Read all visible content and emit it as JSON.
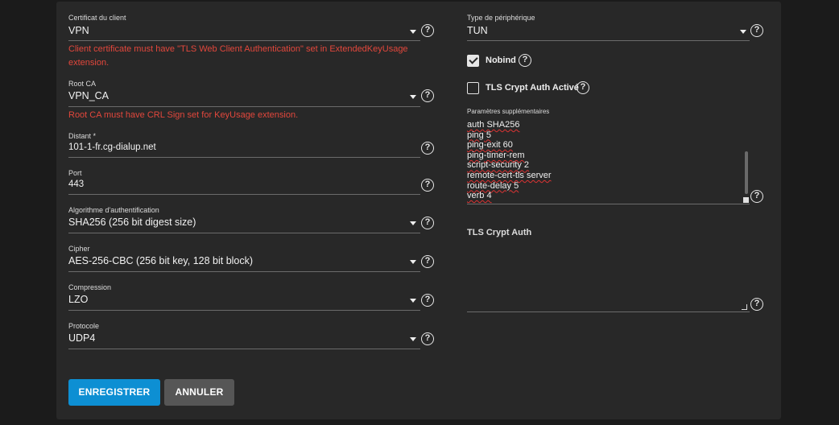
{
  "left": {
    "client_cert": {
      "label": "Certificat du client",
      "value": "VPN",
      "error": "Client certificate must have \"TLS Web Client Authentication\" set in ExtendedKeyUsage extension."
    },
    "root_ca": {
      "label": "Root CA",
      "value": "VPN_CA",
      "error": "Root CA must have CRL Sign set for KeyUsage extension."
    },
    "remote": {
      "label": "Distant *",
      "value": "101-1-fr.cg-dialup.net"
    },
    "port": {
      "label": "Port",
      "value": "443"
    },
    "auth_algo": {
      "label": "Algorithme d'authentification",
      "value": "SHA256 (256 bit digest size)"
    },
    "cipher": {
      "label": "Cipher",
      "value": "AES-256-CBC (256 bit key, 128 bit block)"
    },
    "compression": {
      "label": "Compression",
      "value": "LZO"
    },
    "protocol": {
      "label": "Protocole",
      "value": "UDP4"
    }
  },
  "right": {
    "device_type": {
      "label": "Type de périphérique",
      "value": "TUN"
    },
    "nobind": {
      "label": "Nobind",
      "checked": true
    },
    "tls_crypt": {
      "label": "TLS Crypt Auth Activé",
      "checked": false
    },
    "extra_params": {
      "label": "Paramètres supplémentaires",
      "lines": [
        "auth SHA256",
        "ping 5",
        "ping-exit 60",
        "ping-timer-rem",
        "script-security 2",
        "remote-cert-tls server",
        "route-delay 5",
        "verb 4"
      ]
    },
    "tls_crypt_auth": {
      "label": "TLS Crypt Auth",
      "value": ""
    }
  },
  "help_glyph": "?",
  "buttons": {
    "save": "ENREGISTRER",
    "cancel": "ANNULER"
  },
  "colors": {
    "primary": "#0d8fd3",
    "secondary": "#565656",
    "error": "#e2473c"
  }
}
